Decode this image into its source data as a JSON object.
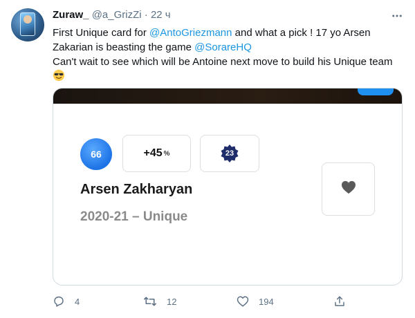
{
  "author": {
    "name": "Zuraw_",
    "handle": "@a_GrizZi",
    "separator": "·",
    "time": "22 ч"
  },
  "tweet": {
    "line1_a": "First Unique card for ",
    "line1_mention": "@AntoGriezmann",
    "line1_b": " and what a pick ! 17 yo Arsen",
    "line2_a": "Zakarian is beasting the game ",
    "line2_mention": "@SorareHQ",
    "line3": "Can't wait to see which will be Antoine next move to build his Unique team"
  },
  "card": {
    "rating": "66",
    "bonus": "+45",
    "bonus_unit": "%",
    "serial": "23",
    "player": "Arsen Zakharyan",
    "season": "2020-21 – Unique"
  },
  "actions": {
    "replies": "4",
    "retweets": "12",
    "likes": "194"
  },
  "colors": {
    "accent": "#1b95e0",
    "muted": "#5b7083",
    "rating": "#1d73e6",
    "badge": "#1f2d6b"
  },
  "icons": [
    "more-icon",
    "smiling-sunglasses-emoji",
    "badge-icon",
    "heart-icon",
    "reply-icon",
    "retweet-icon",
    "like-icon",
    "share-icon"
  ]
}
